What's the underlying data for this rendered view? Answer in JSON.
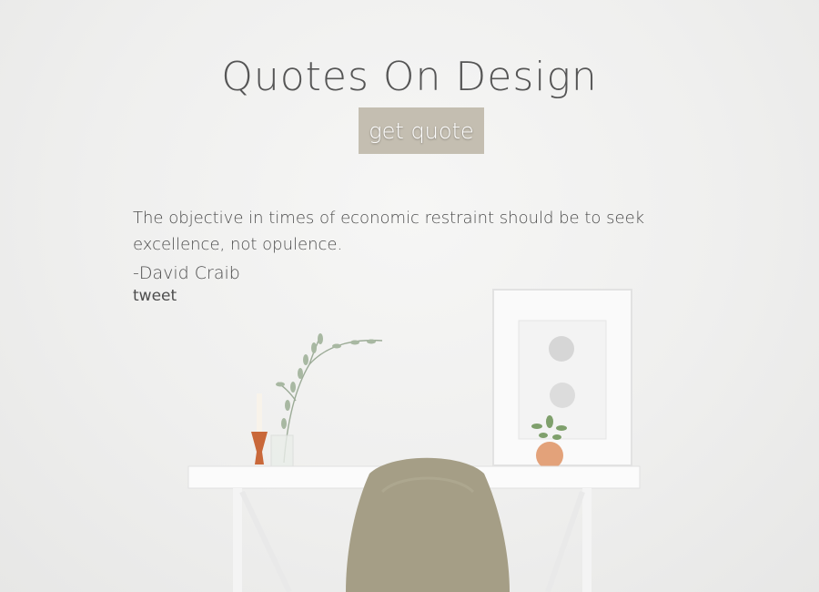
{
  "header": {
    "title": "Quotes On Design"
  },
  "actions": {
    "get_quote_label": "get quote"
  },
  "quote": {
    "text": "The objective in times of economic restraint should be to seek excellence, not opulence.",
    "author": "-David Craib",
    "tweet_label": "tweet"
  },
  "colors": {
    "background": "#efefee",
    "button": "#c4beb1",
    "text": "#4d4d4d",
    "chair": "#a59e86",
    "vase": "#e3a27a"
  }
}
